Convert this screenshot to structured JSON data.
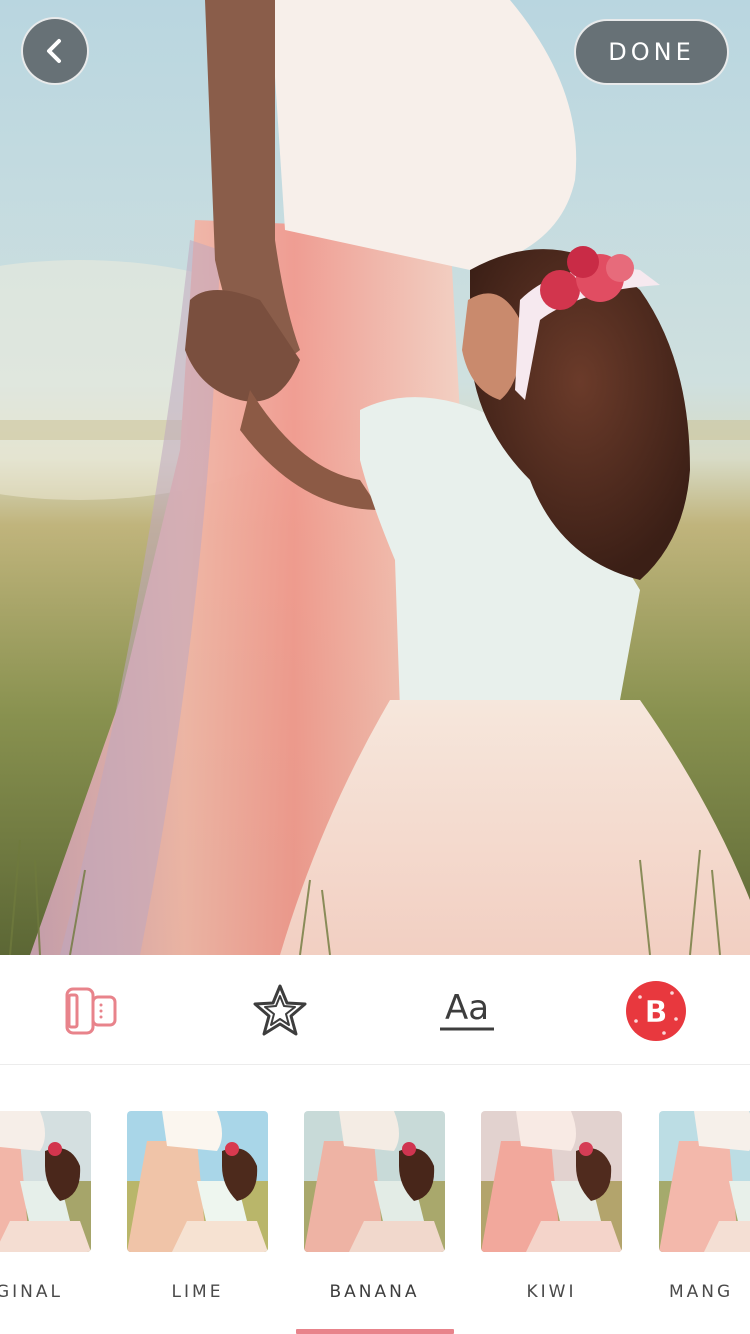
{
  "header": {
    "done_label": "DONE"
  },
  "toolbar": {
    "tools": [
      {
        "icon": "adjust-icon"
      },
      {
        "icon": "sparkle-star-icon"
      },
      {
        "icon": "text-icon",
        "label": "Aa"
      },
      {
        "icon": "sticker-badge-icon",
        "label": "B"
      }
    ]
  },
  "filters": {
    "selected": "BANANA",
    "items": [
      {
        "label": "IGINAL"
      },
      {
        "label": "LIME"
      },
      {
        "label": "BANANA"
      },
      {
        "label": "KIWI"
      },
      {
        "label": "MANG"
      }
    ]
  },
  "colors": {
    "accent": "#e8838b",
    "sticker_red": "#e8383e",
    "button_bg": "#5f686d"
  }
}
